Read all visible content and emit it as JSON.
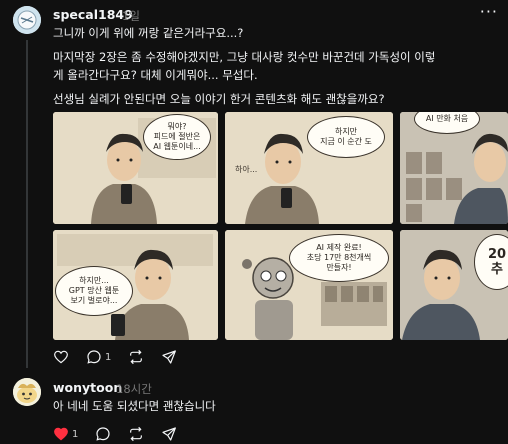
{
  "post": {
    "username": "specal1849",
    "time": "1일",
    "lines": [
      "그니까 이게 위에 꺼랑 같은거라구요...?",
      "마지막장 2장은 좀 수정해야겠지만, 그냥 대사랑 컷수만 바꾼건데 가독성이 이렇",
      "게 올라간다구요? 대체 이게뭐야... 무섭다.",
      "선생님 실례가 안된다면 오늘 이야기 한거 콘텐츠화 해도 괜찮을까요?"
    ],
    "more_icon": "more-icon",
    "reply_count": "1"
  },
  "comic": {
    "panel1_bubble": [
      "뭐야?",
      "피드에 절반은",
      "AI 웹툰이네..."
    ],
    "panel2_bubble": [
      "하지만",
      "지금 이 순간 도"
    ],
    "panel2_small": "하아...",
    "panel3_bubble": [
      "AI 만화 처음"
    ],
    "panel4_bubble": [
      "하지만...",
      "GPT 망산 웹툰",
      "보기 벌로야..."
    ],
    "panel5_bubble": [
      "AI 제작 완료!",
      "초당 17만 8천개씩",
      "만들자!"
    ],
    "panel6_bubble": [
      "20",
      "추"
    ]
  },
  "reply": {
    "username": "wonytoon",
    "time": "18시간",
    "text": "아 네네 도움 되셨다면 괜찮습니다",
    "like_count": "1"
  },
  "colors": {
    "background": "#101010",
    "text": "#f3f5f7",
    "muted": "#777777",
    "like_red": "#ff3040"
  }
}
